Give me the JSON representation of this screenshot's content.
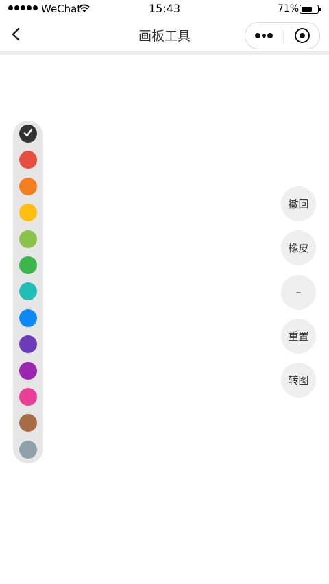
{
  "status_bar": {
    "carrier": "WeChat",
    "time": "15:43",
    "battery_percent": "71%",
    "battery_level": 0.71
  },
  "nav": {
    "title": "画板工具",
    "back_icon": "chevron-left-icon",
    "more_icon": "more-dots-icon",
    "close_icon": "target-circle-icon"
  },
  "palette": {
    "selected_index": 0,
    "colors": [
      "#333333",
      "#e84e40",
      "#f57f20",
      "#ffbf12",
      "#8bc34a",
      "#3cb54a",
      "#1fbdb5",
      "#0e88f5",
      "#6c3bb8",
      "#9b27b0",
      "#e73f95",
      "#a86b47",
      "#8fa0aa"
    ]
  },
  "tools": [
    {
      "label": "撤回"
    },
    {
      "label": "橡皮"
    },
    {
      "label": "–"
    },
    {
      "label": "重置"
    },
    {
      "label": "转图"
    }
  ]
}
